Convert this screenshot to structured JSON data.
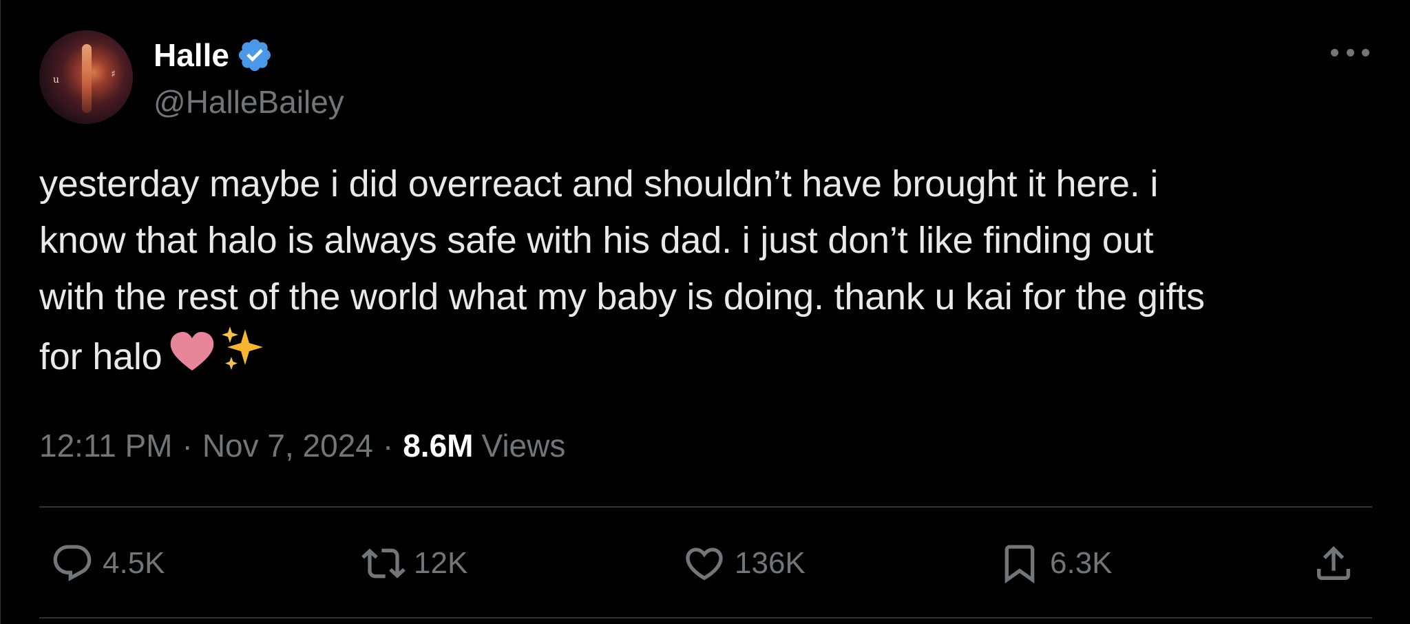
{
  "author": {
    "display_name": "Halle",
    "handle": "@HalleBailey",
    "verified_icon": "verified-badge-icon",
    "verified_color": "#4a99e9"
  },
  "tweet": {
    "text": "yesterday maybe i did overreact and shouldn’t have brought it here. i\nknow that halo is always safe with his dad. i just don’t like finding out\nwith the rest of the world what my baby is doing. thank u kai for the gifts\nfor halo",
    "emojis": [
      "pink-heart-emoji",
      "sparkles-emoji"
    ]
  },
  "meta": {
    "time": "12:11 PM",
    "separator": "·",
    "date": "Nov 7, 2024",
    "views_count": "8.6M",
    "views_label": "Views"
  },
  "actions": {
    "reply_count": "4.5K",
    "retweet_count": "12K",
    "like_count": "136K",
    "bookmark_count": "6.3K",
    "share_icon": "share-icon"
  },
  "colors": {
    "background": "#000000",
    "text": "#e7e9ea",
    "secondary": "#71767b",
    "divider": "#2f3336"
  }
}
